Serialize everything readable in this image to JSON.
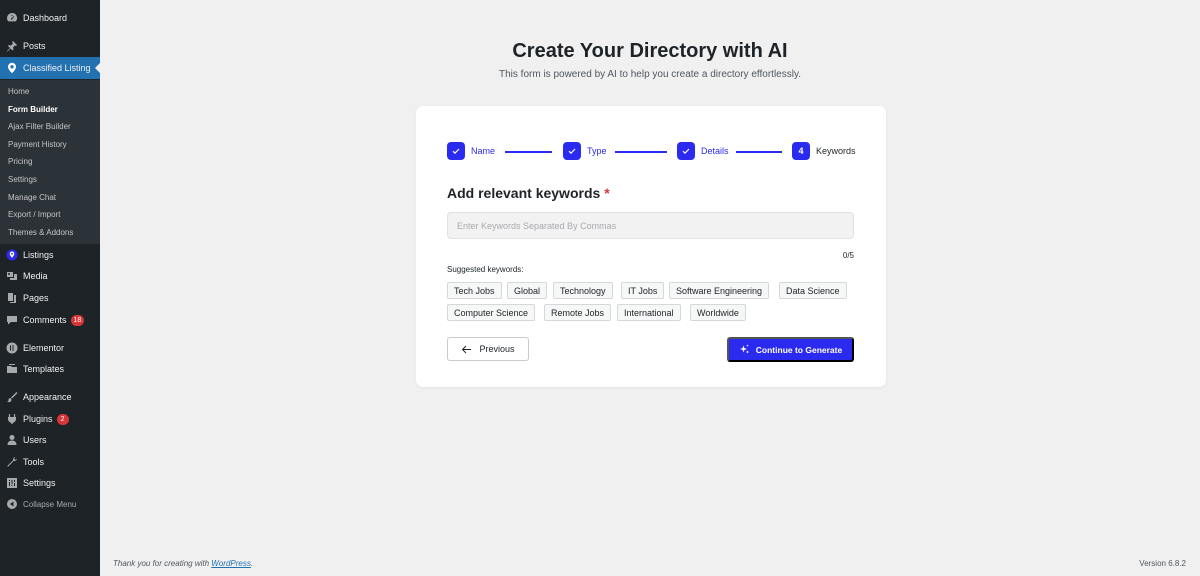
{
  "sidebar": {
    "items": [
      {
        "label": "Dashboard",
        "icon": "dashboard-icon"
      },
      {
        "label": "Posts",
        "icon": "pin-icon"
      },
      {
        "label": "Classified Listing",
        "icon": "location-icon"
      },
      {
        "label": "Listings",
        "icon": "location-icon"
      },
      {
        "label": "Media",
        "icon": "media-icon"
      },
      {
        "label": "Pages",
        "icon": "pages-icon"
      },
      {
        "label": "Comments",
        "icon": "comment-icon",
        "badge": "18"
      },
      {
        "label": "Elementor",
        "icon": "elementor-icon"
      },
      {
        "label": "Templates",
        "icon": "folder-icon"
      },
      {
        "label": "Appearance",
        "icon": "brush-icon"
      },
      {
        "label": "Plugins",
        "icon": "plugin-icon",
        "badge": "2"
      },
      {
        "label": "Users",
        "icon": "user-icon"
      },
      {
        "label": "Tools",
        "icon": "wrench-icon"
      },
      {
        "label": "Settings",
        "icon": "settings-icon"
      },
      {
        "label": "Collapse Menu",
        "icon": "collapse-icon"
      }
    ],
    "submenu": [
      "Home",
      "Form Builder",
      "Ajax Filter Builder",
      "Payment History",
      "Pricing",
      "Settings",
      "Manage Chat",
      "Export / Import",
      "Themes & Addons"
    ]
  },
  "header": {
    "title": "Create Your Directory with AI",
    "subtitle": "This form is powered by AI to help you create a directory effortlessly."
  },
  "stepper": {
    "steps": [
      {
        "label": "Name",
        "state": "done"
      },
      {
        "label": "Type",
        "state": "done"
      },
      {
        "label": "Details",
        "state": "done"
      },
      {
        "label": "Keywords",
        "state": "current",
        "number": "4"
      }
    ]
  },
  "form": {
    "heading": "Add relevant keywords",
    "required_mark": "*",
    "input_placeholder": "Enter Keywords Separated By Commas",
    "input_value": "",
    "counter": "0/5",
    "suggested_label": "Suggested keywords:",
    "suggested": [
      "Tech Jobs",
      "Global",
      "Technology",
      "IT Jobs",
      "Software Engineering",
      "Data Science",
      "Computer Science",
      "Remote Jobs",
      "International",
      "Worldwide"
    ],
    "previous_label": "Previous",
    "continue_label": "Continue to Generate"
  },
  "footer": {
    "thanks_prefix": "Thank you for creating with ",
    "thanks_link": "WordPress",
    "thanks_suffix": ".",
    "version": "Version 6.8.2"
  },
  "colors": {
    "accent": "#2b2bf0",
    "sidebar_bg": "#1d2327",
    "wp_blue": "#2271b1",
    "badge": "#d63638"
  }
}
